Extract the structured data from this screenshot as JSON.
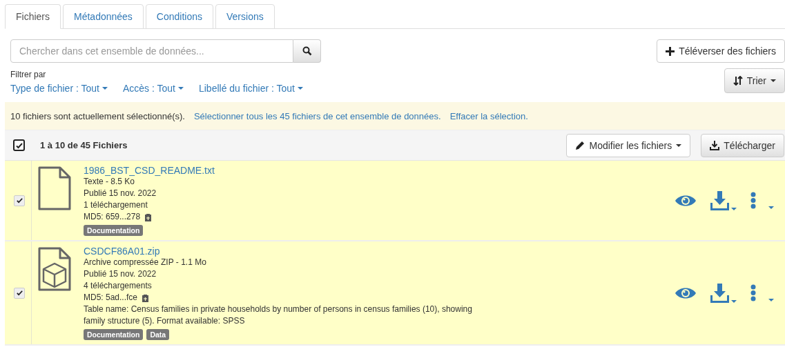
{
  "tabs": [
    {
      "label": "Fichiers",
      "selected": true
    },
    {
      "label": "Métadonnées",
      "selected": false
    },
    {
      "label": "Conditions",
      "selected": false
    },
    {
      "label": "Versions",
      "selected": false
    }
  ],
  "search": {
    "placeholder": "Chercher dans cet ensemble de données..."
  },
  "upload_button": "Téléverser des fichiers",
  "filter": {
    "label": "Filtrer par",
    "filters": [
      "Type de fichier : Tout",
      "Accès : Tout",
      "Libellé du fichier : Tout"
    ]
  },
  "sort_button": "Trier",
  "selection_bar": {
    "message": "10 fichiers sont actuellement sélectionné(s).",
    "select_all": "Sélectionner tous les 45 fichiers de cet ensemble de données.",
    "clear": "Effacer la sélection."
  },
  "header": {
    "checked": true,
    "count": "1 à 10 de 45 Fichiers",
    "edit_button": "Modifier les fichiers",
    "download_button": "Télécharger"
  },
  "files": [
    {
      "checked": true,
      "kind": "text",
      "name": "1986_BST_CSD_README.txt",
      "details": [
        "Texte - 8.5 Ko",
        "Publié 15 nov. 2022",
        "1 téléchargement"
      ],
      "md5": "MD5: 659...278",
      "tags": [
        "Documentation"
      ]
    },
    {
      "checked": true,
      "kind": "archive",
      "name": "CSDCF86A01.zip",
      "details": [
        "Archive compressée ZIP - 1.1 Mo",
        "Publié 15 nov. 2022",
        "4 téléchargements"
      ],
      "md5": "MD5: 5ad...fce",
      "description": "Table name: Census families in private households by number of persons in census families (10), showing family structure (5). Format available: SPSS",
      "tags": [
        "Documentation",
        "Data"
      ]
    }
  ]
}
